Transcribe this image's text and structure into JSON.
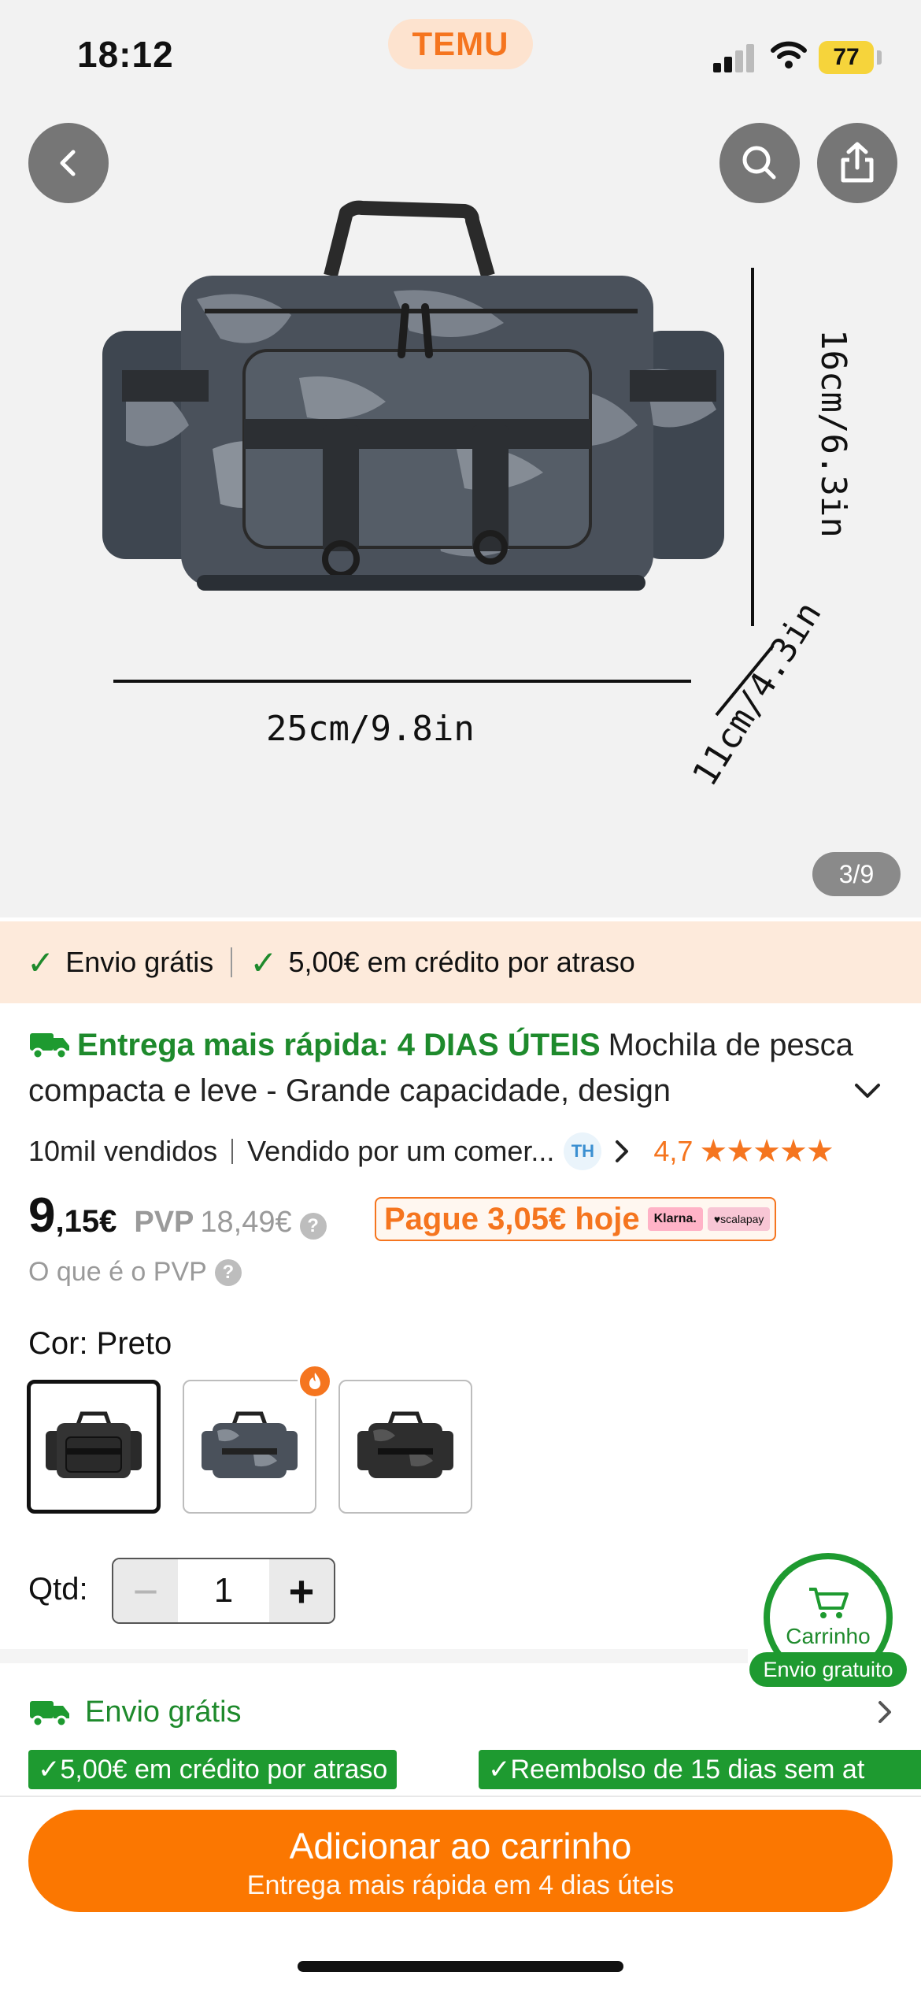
{
  "status_bar": {
    "time": "18:12",
    "battery": "77"
  },
  "app": {
    "brand": "TEMU"
  },
  "gallery": {
    "counter": "3/9",
    "dimensions": {
      "width": "25cm/9.8in",
      "height": "16cm/6.3in",
      "depth": "11cm/4.3in"
    }
  },
  "promo_strip": {
    "item1": "Envio grátis",
    "item2": "5,00€ em crédito por atraso"
  },
  "product": {
    "fast_delivery": "Entrega mais rápida: 4 DIAS ÚTEIS",
    "title": "Mochila de pesca compacta e leve - Grande capacidade, design",
    "sold": "10mil vendidos",
    "seller": "Vendido por um comer...",
    "seller_badge": "TH",
    "rating": "4,7",
    "stars": "★★★★★"
  },
  "price": {
    "integer": "9",
    "decimal": ",15€",
    "pvp_label": "PVP",
    "pvp_value": "18,49€",
    "pay_today": "Pague 3,05€ hoje",
    "klarna": "Klarna.",
    "scalapay": "♥scalapay",
    "pvp_info": "O que é o PVP"
  },
  "color": {
    "label": "Cor: Preto"
  },
  "quantity": {
    "label": "Qtd:",
    "value": "1",
    "minus": "−",
    "plus": "+"
  },
  "cart_widget": {
    "label": "Carrinho",
    "badge": "Envio gratuito"
  },
  "shipping": {
    "title": "Envio grátis",
    "tag1": "✓5,00€ em crédito por atraso",
    "tag2": "✓Reembolso de 15 dias sem at"
  },
  "cta": {
    "main": "Adicionar ao carrinho",
    "sub": "Entrega mais rápida em 4 dias úteis"
  },
  "colors": {
    "accent": "#fb7701",
    "green": "#1e9a30",
    "promo_bg": "#fdeadb"
  }
}
